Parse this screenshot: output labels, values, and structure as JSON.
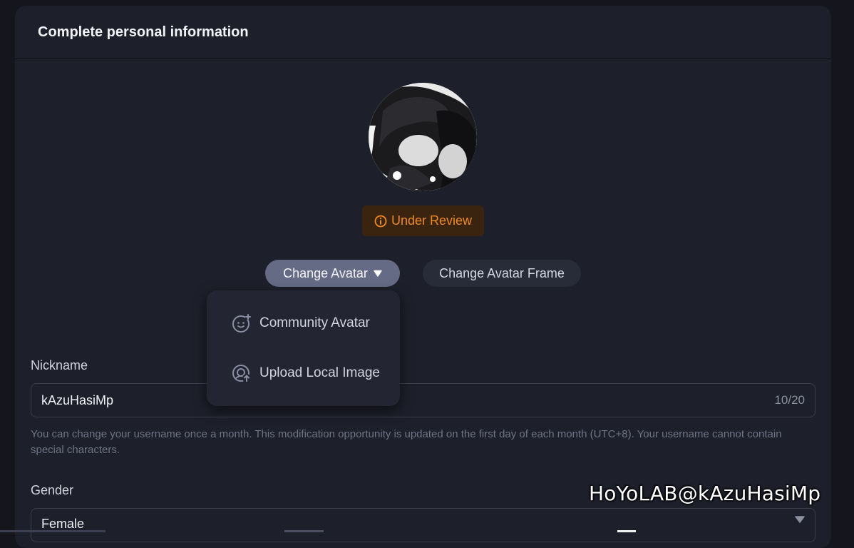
{
  "header": {
    "title": "Complete personal information"
  },
  "avatar": {
    "status": "Under Review"
  },
  "buttons": {
    "change_avatar": "Change Avatar",
    "change_avatar_frame": "Change Avatar Frame"
  },
  "dropdown": {
    "items": [
      {
        "label": "Community Avatar",
        "icon": "community-avatar-icon"
      },
      {
        "label": "Upload Local Image",
        "icon": "upload-image-icon"
      }
    ]
  },
  "nickname": {
    "label": "Nickname",
    "value": "kAzuHasiMp",
    "counter": "10/20",
    "hint": "You can change your username once a month. This modification opportunity is updated on the first day of each month (UTC+8). Your username cannot contain special characters."
  },
  "gender": {
    "label": "Gender",
    "value": "Female"
  },
  "watermark": "HoYoLAB@kAzuHasiMp",
  "colors": {
    "accent": "#f08a24",
    "badge_bg": "#3a2410",
    "pill_active": "#656b85",
    "panel": "#1d1f2a"
  }
}
